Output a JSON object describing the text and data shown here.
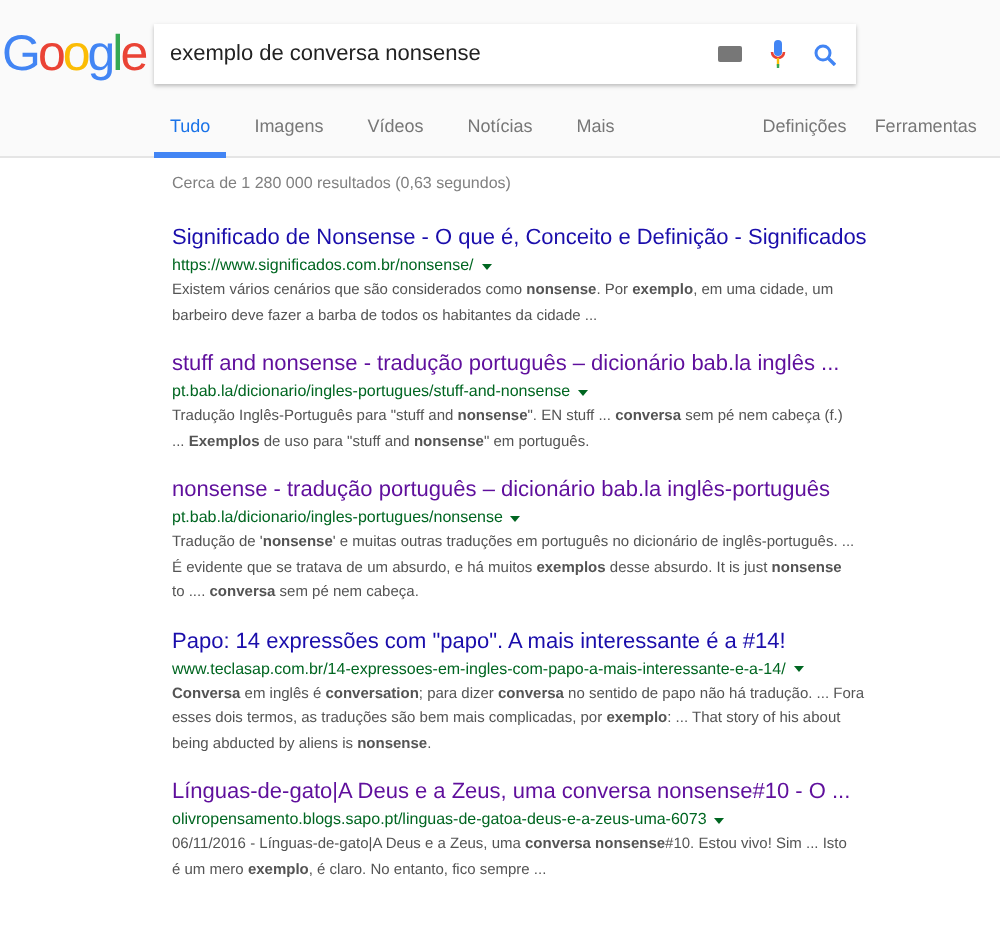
{
  "logo": "Google",
  "search": {
    "value": "exemplo de conversa nonsense"
  },
  "tabs": [
    {
      "label": "Tudo",
      "selected": true
    },
    {
      "label": "Imagens",
      "selected": false
    },
    {
      "label": "Vídeos",
      "selected": false
    },
    {
      "label": "Notícias",
      "selected": false
    },
    {
      "label": "Mais",
      "selected": false
    }
  ],
  "tools": [
    "Definições",
    "Ferramentas"
  ],
  "stats": "Cerca de 1 280 000 resultados (0,63 segundos)",
  "results": [
    {
      "title": "Significado de Nonsense - O que é, Conceito e Definição - Significados",
      "visited": false,
      "url": "https://www.significados.com.br/nonsense/",
      "snippet": [
        "Existem vários cenários que são considerados como **nonsense**. Por **exemplo**, em uma cidade, um",
        "barbeiro deve fazer a barba de todos os habitantes da cidade ..."
      ]
    },
    {
      "title": "stuff and nonsense - tradução português – dicionário bab.la inglês ...",
      "visited": true,
      "url": "pt.bab.la/dicionario/ingles-portugues/stuff-and-nonsense",
      "snippet": [
        "Tradução Inglês-Português para \"stuff and **nonsense**\". EN stuff ... **conversa** sem pé nem cabeça (f.)",
        "... **Exemplos** de uso para \"stuff and **nonsense**\" em português."
      ]
    },
    {
      "title": "nonsense - tradução português – dicionário bab.la inglês-português",
      "visited": true,
      "url": "pt.bab.la/dicionario/ingles-portugues/nonsense",
      "snippet": [
        "Tradução de '**nonsense**' e muitas outras traduções em português no dicionário de inglês-português. ...",
        "É evidente que se tratava de um absurdo, e há muitos **exemplos** desse absurdo. It is just **nonsense**",
        "to .... **conversa** sem pé nem cabeça."
      ]
    },
    {
      "title": "Papo: 14 expressões com \"papo\". A mais interessante é a #14!",
      "visited": false,
      "url": "www.teclasap.com.br/14-expressoes-em-ingles-com-papo-a-mais-interessante-e-a-14/",
      "snippet": [
        "**Conversa** em inglês é **conversation**; para dizer **conversa** no sentido de papo não há tradução. ... Fora",
        "esses dois termos, as traduções são bem mais complicadas, por **exemplo**: ... That story of his about",
        "being abducted by aliens is **nonsense**."
      ]
    },
    {
      "title": "Línguas-de-gato|A Deus e a Zeus, uma conversa nonsense#10 - O ...",
      "visited": true,
      "url": "olivropensamento.blogs.sapo.pt/linguas-de-gatoa-deus-e-a-zeus-uma-6073",
      "snippet": [
        "06/11/2016 - Línguas-de-gato|A Deus e a Zeus, uma **conversa nonsense**#10. Estou vivo! Sim ... Isto",
        "é um mero **exemplo**, é claro. No entanto, fico sempre ..."
      ]
    }
  ]
}
